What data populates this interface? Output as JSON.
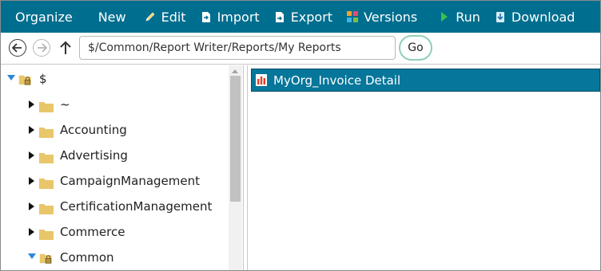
{
  "toolbar": {
    "organize": "Organize",
    "new": "New",
    "edit": "Edit",
    "import": "Import",
    "export": "Export",
    "versions": "Versions",
    "run": "Run",
    "download": "Download"
  },
  "address": {
    "path": "$/Common/Report Writer/Reports/My Reports",
    "go": "Go"
  },
  "tree": {
    "root": "$",
    "items": [
      {
        "label": "~",
        "expanded": false
      },
      {
        "label": "Accounting",
        "expanded": false
      },
      {
        "label": "Advertising",
        "expanded": false
      },
      {
        "label": "CampaignManagement",
        "expanded": false
      },
      {
        "label": "CertificationManagement",
        "expanded": false
      },
      {
        "label": "Commerce",
        "expanded": false
      },
      {
        "label": "Common",
        "expanded": true,
        "locked": true
      }
    ]
  },
  "content": {
    "selected_item": "MyOrg_Invoice Detail"
  },
  "colors": {
    "toolbar_bg": "#006e8e",
    "selected_row": "#06769a",
    "folder": "#e8c66a",
    "expand_arrow": "#2a88d8"
  }
}
